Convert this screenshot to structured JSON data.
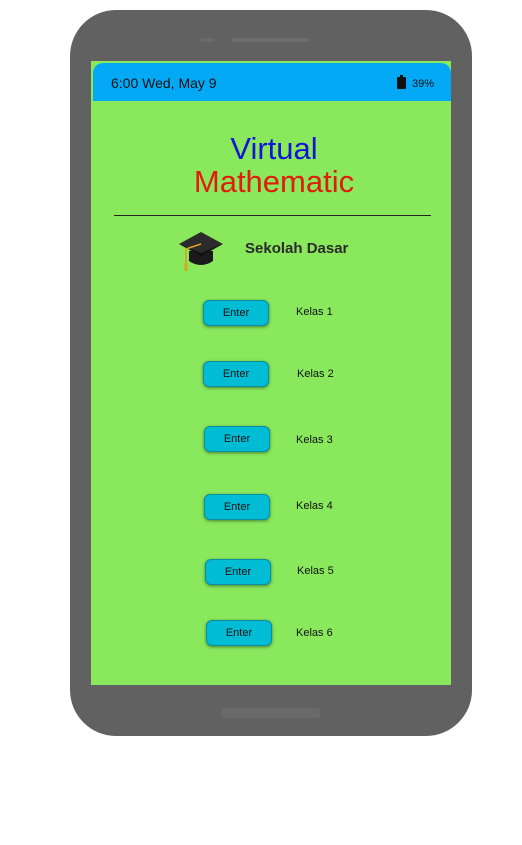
{
  "status_bar": {
    "time_date": "6:00  Wed, May 9",
    "battery": "39%"
  },
  "header": {
    "title_part1": "Virtual",
    "title_part2": "Mathematic"
  },
  "section": {
    "icon": "graduation-cap-icon",
    "title": "Sekolah Dasar"
  },
  "classes": [
    {
      "button_label": "Enter",
      "label": "Kelas 1"
    },
    {
      "button_label": "Enter",
      "label": "Kelas 2"
    },
    {
      "button_label": "Enter",
      "label": "Kelas 3"
    },
    {
      "button_label": "Enter",
      "label": "Kelas 4"
    },
    {
      "button_label": "Enter",
      "label": "Kelas 5"
    },
    {
      "button_label": "Enter",
      "label": "Kelas 6"
    }
  ],
  "colors": {
    "screen_background": "#89e85c",
    "status_bar": "#03a9f4",
    "title_part1": "#1414d6",
    "title_part2": "#e21c0c",
    "button": "#00bcd4",
    "phone_frame": "#616161"
  }
}
